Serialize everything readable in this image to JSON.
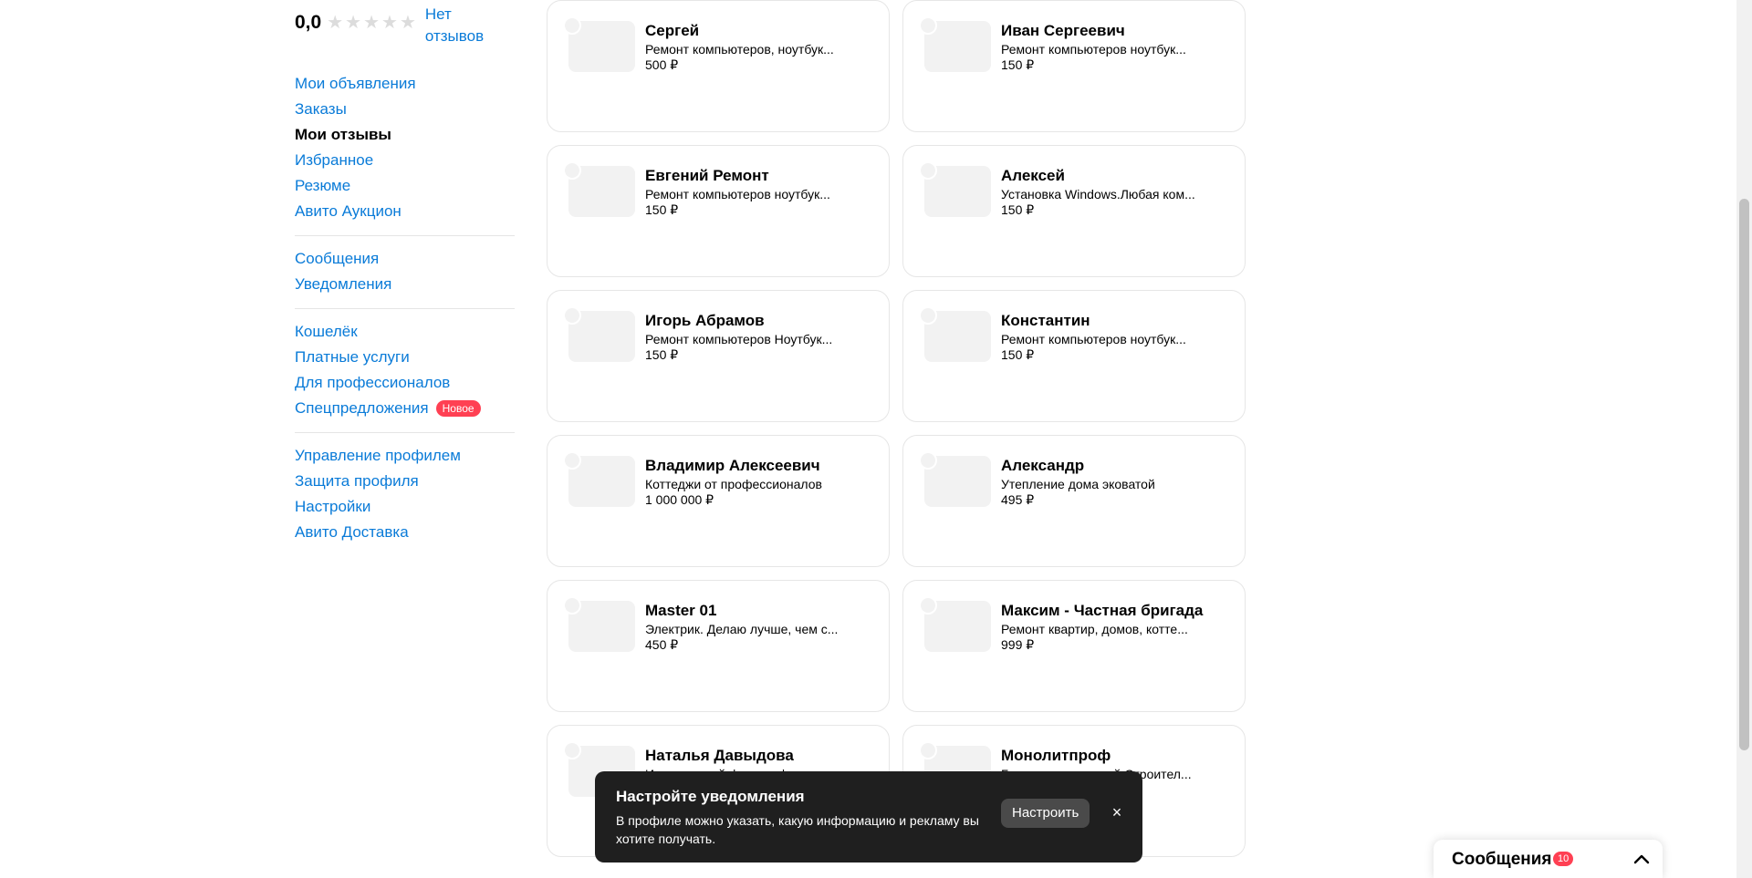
{
  "rating": {
    "value": "0,0",
    "stars": 5,
    "no_reviews": "Нет отзывов"
  },
  "menu_groups": [
    [
      {
        "label": "Мои объявления",
        "active": false
      },
      {
        "label": "Заказы",
        "active": false
      },
      {
        "label": "Мои отзывы",
        "active": true
      },
      {
        "label": "Избранное",
        "active": false
      },
      {
        "label": "Резюме",
        "active": false
      },
      {
        "label": "Авито Аукцион",
        "active": false
      }
    ],
    [
      {
        "label": "Сообщения",
        "active": false
      },
      {
        "label": "Уведомления",
        "active": false
      }
    ],
    [
      {
        "label": "Кошелёк",
        "active": false
      },
      {
        "label": "Платные услуги",
        "active": false
      },
      {
        "label": "Для профессионалов",
        "active": false
      },
      {
        "label": "Спецпредложения",
        "active": false,
        "badge": "Новое"
      }
    ],
    [
      {
        "label": "Управление профилем",
        "active": false
      },
      {
        "label": "Защита профиля",
        "active": false
      },
      {
        "label": "Настройки",
        "active": false
      },
      {
        "label": "Авито Доставка",
        "active": false
      }
    ]
  ],
  "cards": [
    {
      "title": "Сергей",
      "desc": "Ремонт компьютеров, ноутбук...",
      "price": "500 ₽"
    },
    {
      "title": "Иван Сергеевич",
      "desc": "Ремонт компьютеров ноутбук...",
      "price": "150 ₽"
    },
    {
      "title": "Евгений Ремонт",
      "desc": "Ремонт компьютеров ноутбук...",
      "price": "150 ₽"
    },
    {
      "title": "Алексей",
      "desc": "Установка Windows.Любая ком...",
      "price": "150 ₽"
    },
    {
      "title": "Игорь Абрамов",
      "desc": "Ремонт компьютеров Ноутбук...",
      "price": "150 ₽"
    },
    {
      "title": "Константин",
      "desc": "Ремонт компьютеров ноутбук...",
      "price": "150 ₽"
    },
    {
      "title": "Владимир Алексеевич",
      "desc": "Коттеджи от профессионалов",
      "price": "1 000 000 ₽"
    },
    {
      "title": "Александр",
      "desc": "Утепление дома эковатой",
      "price": "495 ₽"
    },
    {
      "title": "Master 01",
      "desc": "Электрик. Делаю лучше, чем с...",
      "price": "450 ₽"
    },
    {
      "title": "Максим - Частная бригада",
      "desc": "Ремонт квартир, домов, котте...",
      "price": "999 ₽"
    },
    {
      "title": "Наталья Давыдова",
      "desc": "Интерьерный фотограф, доме...",
      "price": ""
    },
    {
      "title": "Монолитпроф",
      "desc": "Бригада строителей.Строител...",
      "price": ""
    }
  ],
  "toast": {
    "title": "Настройте уведомления",
    "text": "В профиле можно указать, какую информацию и рекламу вы хотите получать.",
    "button": "Настроить",
    "close": "×"
  },
  "messages_widget": {
    "label": "Сообщения",
    "count": "10"
  },
  "colors": {
    "link": "#0a7bd8",
    "badge": "#ff4053",
    "toast_bg": "#1f1f1f"
  }
}
